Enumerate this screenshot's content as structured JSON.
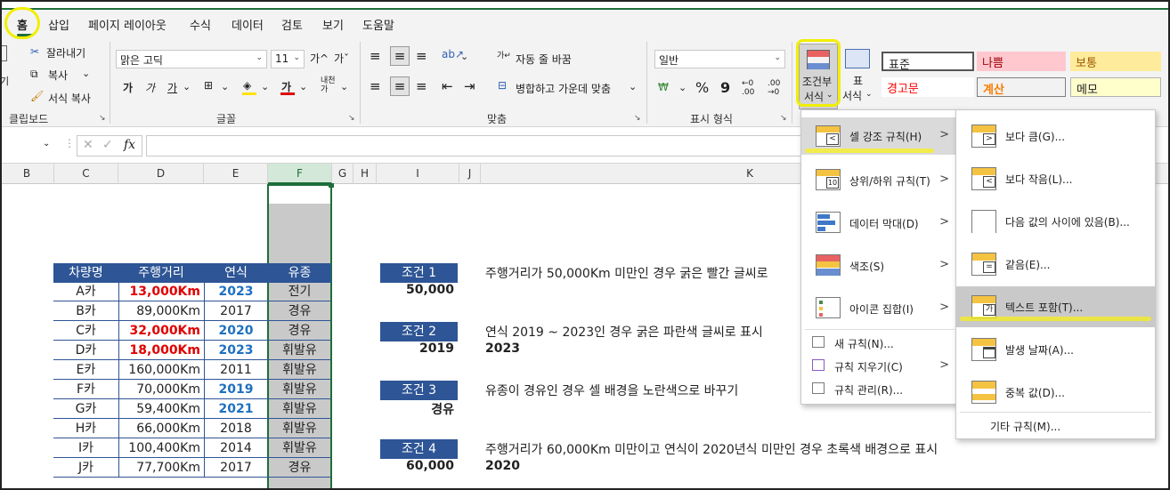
{
  "menu_tabs": [
    "홈",
    "삽입",
    "페이지 레이아웃",
    "수식",
    "데이터",
    "검토",
    "보기",
    "도움말"
  ],
  "ribbon": {
    "clipboard": {
      "cut": "잘라내기",
      "copy": "복사",
      "format_painter": "서식 복사",
      "paste_partial": "기",
      "label": "클립보드"
    },
    "font": {
      "name": "맑은 고딕",
      "size": "11",
      "grow": "가^",
      "shrink": "가ˇ",
      "bold": "가",
      "italic": "가",
      "underline": "가",
      "label": "글꼴"
    },
    "align": {
      "wrap": "자동 줄 바꿈",
      "merge": "병합하고 가운데 맞춤",
      "label": "맞춤"
    },
    "number": {
      "format": "일반",
      "percent": "%",
      "comma": "9",
      "label": "표시 형식"
    },
    "styles": {
      "cond_format": [
        "조건부",
        "서식"
      ],
      "table_format": [
        "표",
        "서식"
      ],
      "cells": [
        {
          "text": "표준",
          "bg": "#ffffff",
          "color": "#222222"
        },
        {
          "text": "나쁨",
          "bg": "#ffc7ce",
          "color": "#9c0006"
        },
        {
          "text": "보통",
          "bg": "#ffeb9c",
          "color": "#9c5700"
        },
        {
          "text": "경고문",
          "bg": "#ffffff",
          "color": "#ff0000"
        },
        {
          "text": "계산",
          "bg": "#f2f2f2",
          "color": "#fa7d00"
        },
        {
          "text": "메모",
          "bg": "#ffffcc",
          "color": "#222222"
        }
      ]
    }
  },
  "formula_bar": {
    "fx": "fx"
  },
  "columns": [
    "B",
    "C",
    "D",
    "E",
    "F",
    "G",
    "H",
    "I",
    "J",
    "K"
  ],
  "table": {
    "headers": [
      "차량명",
      "주행거리",
      "연식",
      "유종"
    ],
    "rows": [
      {
        "name": "A카",
        "dist": "13,000Km",
        "year": "2023",
        "fuel": "전기",
        "dist_red": true,
        "year_blue": true
      },
      {
        "name": "B카",
        "dist": "89,000Km",
        "year": "2017",
        "fuel": "경유",
        "dist_red": false,
        "year_blue": false
      },
      {
        "name": "C카",
        "dist": "32,000Km",
        "year": "2020",
        "fuel": "경유",
        "dist_red": true,
        "year_blue": true
      },
      {
        "name": "D카",
        "dist": "18,000Km",
        "year": "2023",
        "fuel": "휘발유",
        "dist_red": true,
        "year_blue": true
      },
      {
        "name": "E카",
        "dist": "160,000Km",
        "year": "2011",
        "fuel": "휘발유",
        "dist_red": false,
        "year_blue": false
      },
      {
        "name": "F카",
        "dist": "70,000Km",
        "year": "2019",
        "fuel": "휘발유",
        "dist_red": false,
        "year_blue": true
      },
      {
        "name": "G카",
        "dist": "59,400Km",
        "year": "2021",
        "fuel": "휘발유",
        "dist_red": false,
        "year_blue": true
      },
      {
        "name": "H카",
        "dist": "66,000Km",
        "year": "2018",
        "fuel": "휘발유",
        "dist_red": false,
        "year_blue": false
      },
      {
        "name": "I카",
        "dist": "100,400Km",
        "year": "2014",
        "fuel": "휘발유",
        "dist_red": false,
        "year_blue": false
      },
      {
        "name": "J카",
        "dist": "77,700Km",
        "year": "2017",
        "fuel": "경유",
        "dist_red": false,
        "year_blue": false
      }
    ]
  },
  "conditions": [
    {
      "label": "조건 1",
      "value": "50,000",
      "value2": "",
      "desc": "주행거리가 50,000Km 미만인 경우 굵은 빨간 글씨로"
    },
    {
      "label": "조건 2",
      "value": "2019",
      "value2": "2023",
      "desc": "연식 2019 ~ 2023인 경우 굵은 파란색 글씨로 표시"
    },
    {
      "label": "조건 3",
      "value": "경유",
      "value2": "",
      "desc": "유종이 경유인 경우 셀 배경을 노란색으로 바꾸기"
    },
    {
      "label": "조건 4",
      "value": "60,000",
      "value2": "2020",
      "desc": "주행거리가 60,000Km 미만이고 연식이 2020년식 미만인 경우 초록색 배경으로 표시"
    }
  ],
  "cf_menu": {
    "items": [
      {
        "label": "셀 강조 규칙(H)",
        "icon": "highlight-cells-icon"
      },
      {
        "label": "상위/하위 규칙(T)",
        "icon": "top-bottom-icon"
      },
      {
        "label": "데이터 막대(D)",
        "icon": "data-bars-icon"
      },
      {
        "label": "색조(S)",
        "icon": "color-scales-icon"
      },
      {
        "label": "아이콘 집합(I)",
        "icon": "icon-sets-icon"
      }
    ],
    "small_items": [
      "새 규칙(N)...",
      "규칙 지우기(C)",
      "규칙 관리(R)..."
    ]
  },
  "submenu": {
    "items": [
      "보다 큼(G)...",
      "보다 작음(L)...",
      "다음 값의 사이에 있음(B)...",
      "같음(E)...",
      "텍스트 포함(T)...",
      "발생 날짜(A)...",
      "중복 값(D)..."
    ],
    "more": "기타 규칙(M)..."
  }
}
